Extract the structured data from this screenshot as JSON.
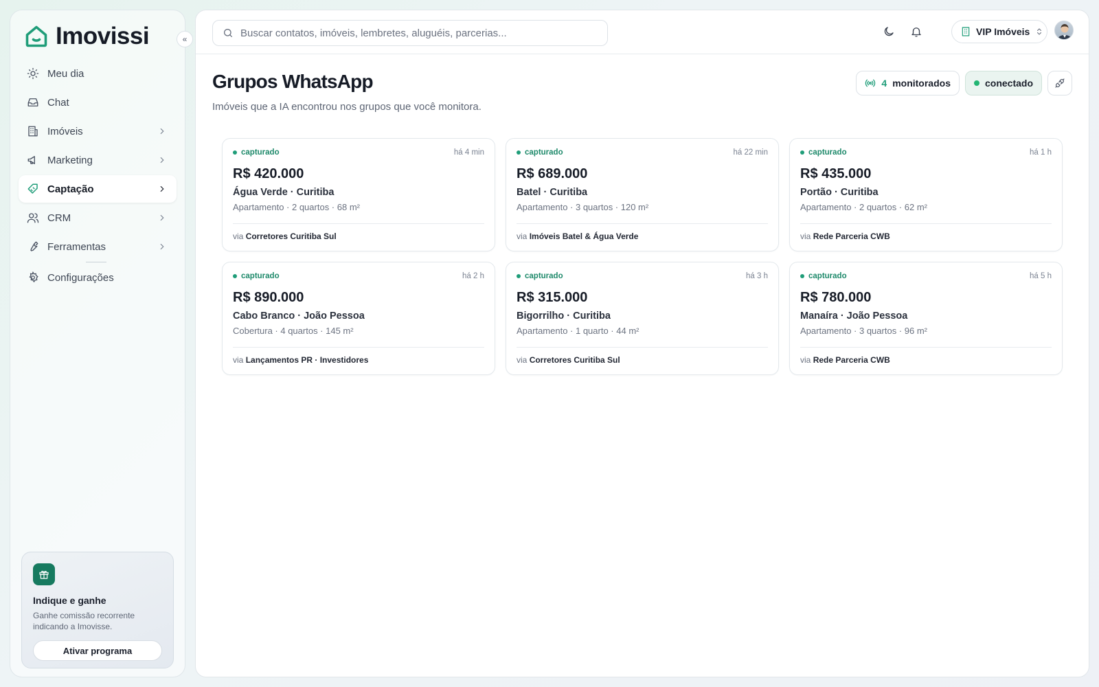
{
  "brand": {
    "name": "Imovissi"
  },
  "sidebar": {
    "items": [
      {
        "label": "Meu dia",
        "icon": "sun-icon"
      },
      {
        "label": "Chat",
        "icon": "inbox-icon"
      },
      {
        "label": "Imóveis",
        "icon": "building-icon"
      },
      {
        "label": "Marketing",
        "icon": "megaphone-icon"
      },
      {
        "label": "Captação",
        "icon": "tag-icon"
      },
      {
        "label": "CRM",
        "icon": "users-icon"
      },
      {
        "label": "Ferramentas",
        "icon": "wrench-icon"
      },
      {
        "label": "Configurações",
        "icon": "gear-icon"
      }
    ],
    "promo": {
      "title": "Indique e ganhe",
      "description": "Ganhe comissão recorrente indicando a Imovisse.",
      "button": "Ativar programa"
    }
  },
  "topbar": {
    "search_placeholder": "Buscar contatos, imóveis, lembretes, aluguéis, parcerias...",
    "org": "VIP Imóveis"
  },
  "page": {
    "title": "Grupos WhatsApp",
    "subtitle": "Imóveis que a IA encontrou nos grupos que você monitora.",
    "monitored_count": "4",
    "monitored_label": "monitorados",
    "status": "conectado"
  },
  "listings": [
    {
      "status": "capturado",
      "time": "há 4 min",
      "price": "R$ 420.000",
      "location": "Água Verde · Curitiba",
      "details": "Apartamento · 2 quartos · 68 m²",
      "via_label": "via",
      "group": "Corretores Curitiba Sul"
    },
    {
      "status": "capturado",
      "time": "há 22 min",
      "price": "R$ 689.000",
      "location": "Batel · Curitiba",
      "details": "Apartamento · 3 quartos · 120 m²",
      "via_label": "via",
      "group": "Imóveis Batel & Água Verde"
    },
    {
      "status": "capturado",
      "time": "há 1 h",
      "price": "R$ 435.000",
      "location": "Portão · Curitiba",
      "details": "Apartamento · 2 quartos · 62 m²",
      "via_label": "via",
      "group": "Rede Parceria CWB"
    },
    {
      "status": "capturado",
      "time": "há 2 h",
      "price": "R$ 890.000",
      "location": "Cabo Branco · João Pessoa",
      "details": "Cobertura · 4 quartos · 145 m²",
      "via_label": "via",
      "group": "Lançamentos PR · Investidores"
    },
    {
      "status": "capturado",
      "time": "há 3 h",
      "price": "R$ 315.000",
      "location": "Bigorrilho · Curitiba",
      "details": "Apartamento · 1 quarto · 44 m²",
      "via_label": "via",
      "group": "Corretores Curitiba Sul"
    },
    {
      "status": "capturado",
      "time": "há 5 h",
      "price": "R$ 780.000",
      "location": "Manaíra · João Pessoa",
      "details": "Apartamento · 3 quartos · 96 m²",
      "via_label": "via",
      "group": "Rede Parceria CWB"
    }
  ],
  "colors": {
    "accent": "#1f9d79",
    "status_connected": "#22b573"
  }
}
